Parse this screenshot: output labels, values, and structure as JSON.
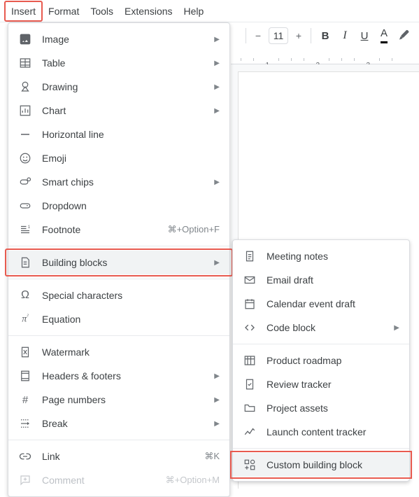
{
  "menubar": {
    "items": [
      "Insert",
      "Format",
      "Tools",
      "Extensions",
      "Help"
    ],
    "active_index": 0
  },
  "toolbar": {
    "font_size": "11",
    "bold": "B",
    "italic": "I",
    "underline": "U",
    "text_color_letter": "A"
  },
  "ruler": {
    "numbers": [
      "1",
      "2",
      "3"
    ]
  },
  "menu": {
    "items": [
      {
        "label": "Image",
        "icon": "image-icon",
        "submenu": true
      },
      {
        "label": "Table",
        "icon": "table-icon",
        "submenu": true
      },
      {
        "label": "Drawing",
        "icon": "drawing-icon",
        "submenu": true
      },
      {
        "label": "Chart",
        "icon": "chart-icon",
        "submenu": true
      },
      {
        "label": "Horizontal line",
        "icon": "horizontal-line-icon"
      },
      {
        "label": "Emoji",
        "icon": "emoji-icon"
      },
      {
        "label": "Smart chips",
        "icon": "smart-chips-icon",
        "submenu": true
      },
      {
        "label": "Dropdown",
        "icon": "dropdown-icon"
      },
      {
        "label": "Footnote",
        "icon": "footnote-icon",
        "shortcut": "⌘+Option+F"
      },
      {
        "label": "Building blocks",
        "icon": "building-blocks-icon",
        "submenu": true,
        "hovered": true,
        "highlight": true
      },
      {
        "label": "Special characters",
        "icon": "special-chars-icon"
      },
      {
        "label": "Equation",
        "icon": "equation-icon"
      },
      {
        "label": "Watermark",
        "icon": "watermark-icon"
      },
      {
        "label": "Headers & footers",
        "icon": "headers-footers-icon",
        "submenu": true
      },
      {
        "label": "Page numbers",
        "icon": "page-numbers-icon",
        "submenu": true
      },
      {
        "label": "Break",
        "icon": "break-icon",
        "submenu": true
      },
      {
        "label": "Link",
        "icon": "link-icon",
        "shortcut": "⌘K"
      },
      {
        "label": "Comment",
        "icon": "comment-icon",
        "shortcut": "⌘+Option+M",
        "disabled": true
      }
    ],
    "dividers_after": [
      8,
      9,
      11,
      15
    ]
  },
  "submenu": {
    "items": [
      {
        "label": "Meeting notes",
        "icon": "meeting-notes-icon"
      },
      {
        "label": "Email draft",
        "icon": "email-draft-icon"
      },
      {
        "label": "Calendar event draft",
        "icon": "calendar-event-icon"
      },
      {
        "label": "Code block",
        "icon": "code-block-icon",
        "submenu": true
      },
      {
        "label": "Product roadmap",
        "icon": "roadmap-icon"
      },
      {
        "label": "Review tracker",
        "icon": "review-tracker-icon"
      },
      {
        "label": "Project assets",
        "icon": "project-assets-icon"
      },
      {
        "label": "Launch content tracker",
        "icon": "launch-tracker-icon"
      },
      {
        "label": "Custom building block",
        "icon": "custom-block-icon",
        "hovered": true,
        "highlight": true
      }
    ],
    "dividers_after": [
      3,
      7
    ]
  }
}
